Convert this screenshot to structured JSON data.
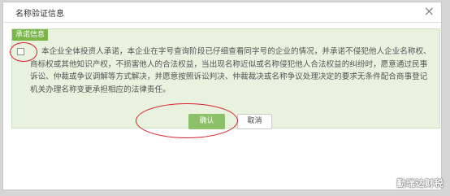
{
  "dialog": {
    "title": "名称验证信息",
    "close_glyph": "×"
  },
  "notice": {
    "tag": "承诺信息",
    "text": "本企业全体投资人承诺，本企业在字号查询阶段已仔细查看同字号的企业的情况，并承诺不侵犯他人企业名称权、商标权或其他知识产权，不损害他人的合法权益，当出现名称近似或名称侵犯他人合法权益的纠纷时，愿意通过民事诉讼、仲裁或争议调解等方式解决，并愿意按照诉讼判决、仲裁裁决或名称争议处理决定的要求无条件配合商事登记机关办理名称变更承担相应的法律责任。",
    "checked": false
  },
  "buttons": {
    "confirm_label": "确认",
    "cancel_label": "取消"
  },
  "watermark": {
    "text": "勤瑞达财税"
  },
  "colors": {
    "accent_green": "#8cc16a",
    "notice_bg": "#e8f2de",
    "highlight_red": "#d9202a"
  }
}
